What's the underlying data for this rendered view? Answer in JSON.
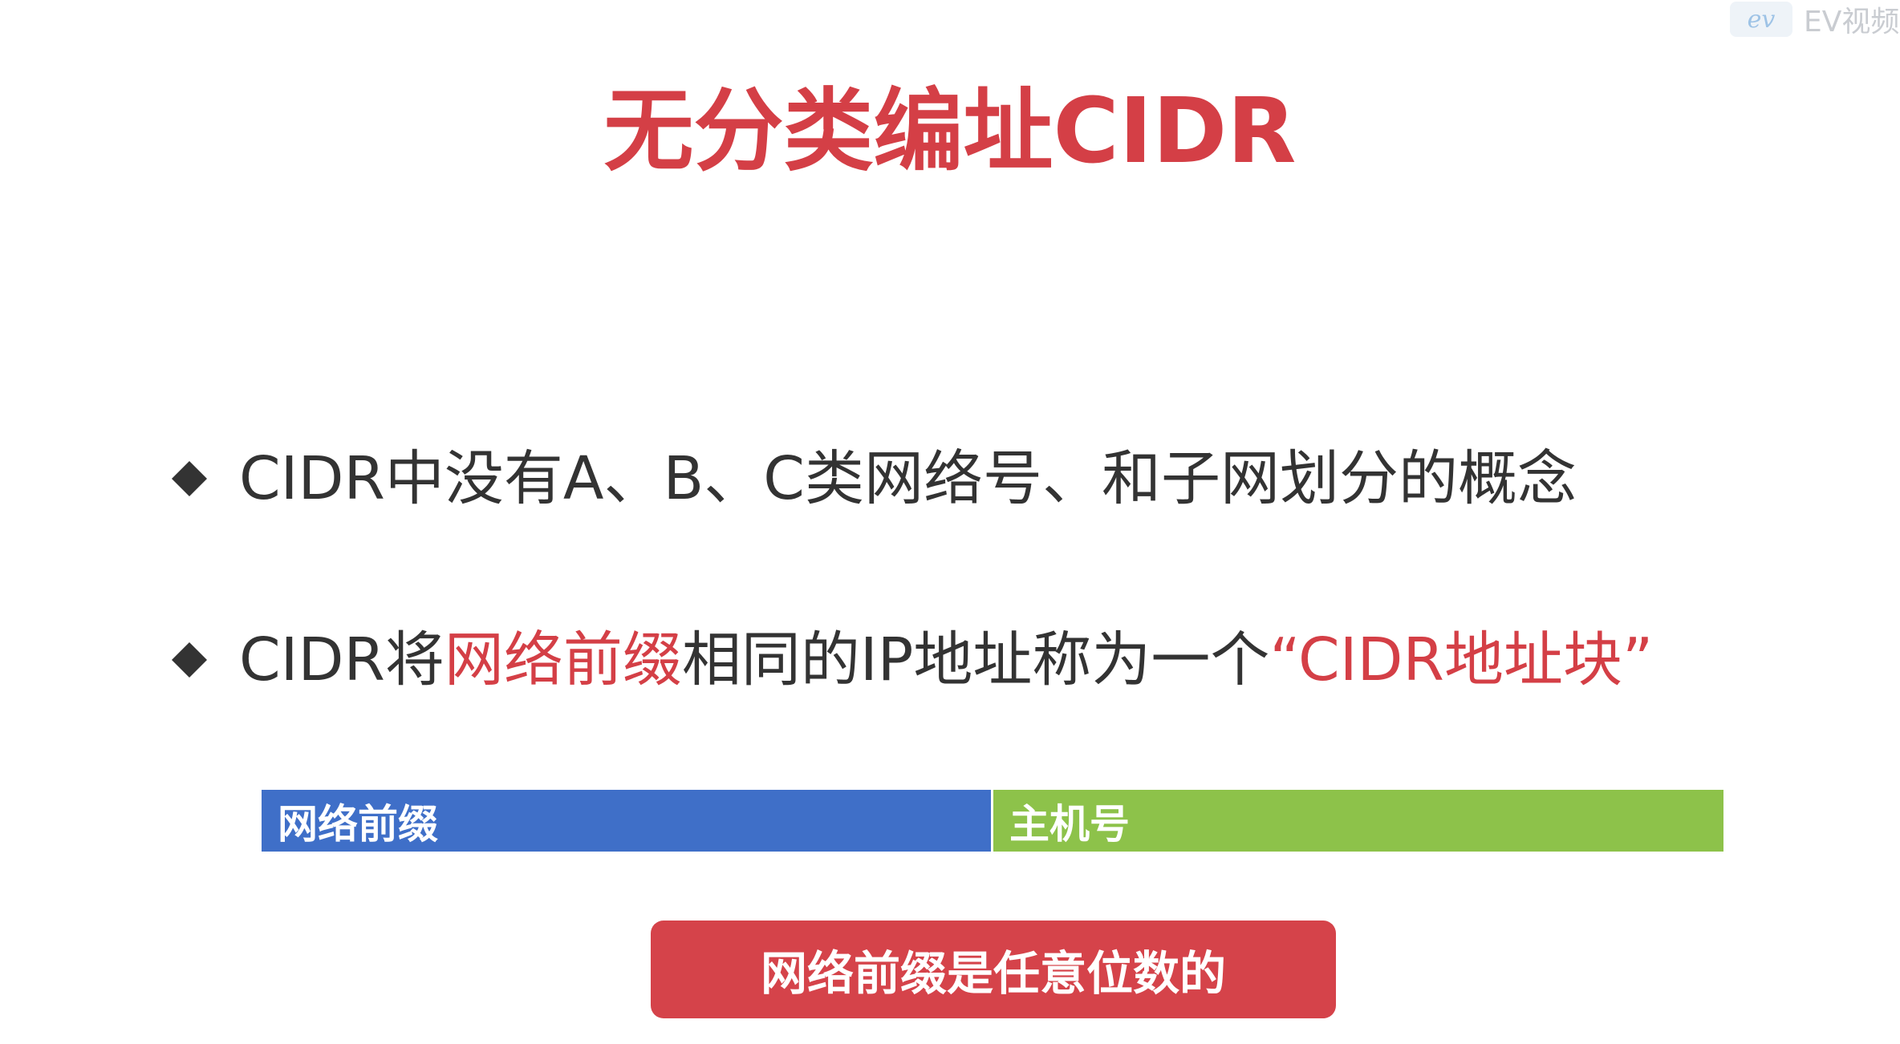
{
  "watermark": {
    "logo_text": "ev",
    "app_name": "EV视频"
  },
  "slide": {
    "title": "无分类编址CIDR",
    "bullets": [
      {
        "text": "CIDR中没有A、B、C类网络号、和子网划分的概念"
      },
      {
        "part1": "CIDR将",
        "highlight1": "网络前缀",
        "part2": "相同的IP地址称为一个",
        "highlight2": "“CIDR地址块”"
      }
    ],
    "bar": {
      "prefix_label": "网络前缀",
      "host_label": "主机号"
    },
    "callout": "网络前缀是任意位数的"
  },
  "colors": {
    "title": "#d43f46",
    "highlight": "#d43f46",
    "prefix_segment": "#3f6fc8",
    "host_segment": "#8dc24a",
    "callout_bg": "#d5434a",
    "body_text": "#333333"
  },
  "icons": {
    "bullet": "diamond-bullet-icon"
  }
}
